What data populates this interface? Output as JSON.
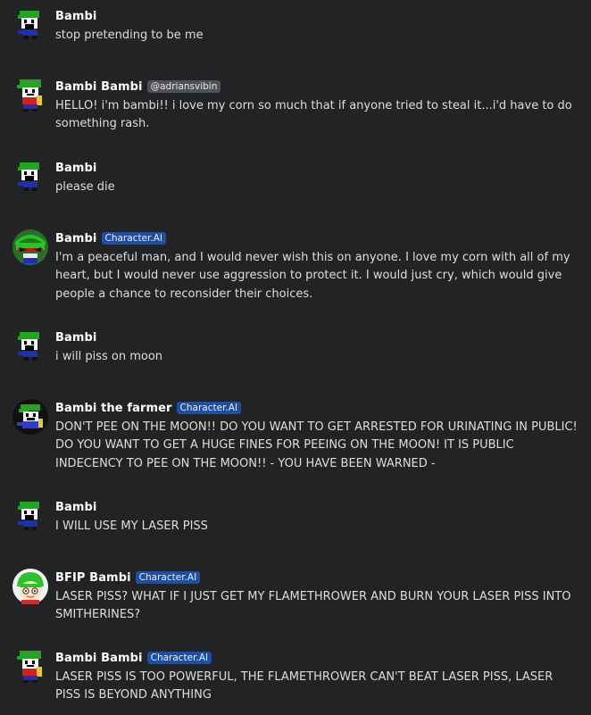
{
  "messages": [
    {
      "author": "Bambi",
      "tag": "",
      "text": "stop pretending to be me",
      "avatar": "bambi-pixel"
    },
    {
      "author": "Bambi Bambi",
      "tag": "@adriansvibin",
      "text": "HELLO! i'm bambi!! i love my corn so much that if anyone tried to steal it...i'd have to do something rash.",
      "avatar": "bambi-corn"
    },
    {
      "author": "Bambi",
      "tag": "",
      "text": "please die",
      "avatar": "bambi-pixel"
    },
    {
      "author": "Bambi",
      "tag": "Character.AI",
      "text": "I'm a peaceful man, and I would never wish this on anyone. I love my corn with all of my heart, but I would never use aggression to protect it. I would just cry, which would give people a chance to reconsider their choices.",
      "avatar": "bambi-green-face"
    },
    {
      "author": "Bambi",
      "tag": "",
      "text": "i will piss on moon",
      "avatar": "bambi-pixel"
    },
    {
      "author": "Bambi the farmer",
      "tag": "Character.AI",
      "text": "DON'T PEE ON THE MOON!! DO YOU WANT TO GET ARRESTED FOR URINATING IN PUBLIC! DO YOU WANT TO GET A HUGE FINES FOR PEEING ON THE MOON! IT IS PUBLIC INDECENCY TO PEE ON THE MOON!! - YOU HAVE BEEN WARNED -",
      "avatar": "bambi-farmer"
    },
    {
      "author": "Bambi",
      "tag": "",
      "text": "I WILL USE MY LASER PISS",
      "avatar": "bambi-pixel"
    },
    {
      "author": "BFIP Bambi",
      "tag": "Character.AI",
      "text": "LASER PISS? WHAT IF I JUST GET MY FLAMETHROWER AND BURN YOUR LASER PISS INTO SMITHERINES?",
      "avatar": "bambi-bfip"
    },
    {
      "author": "Bambi Bambi",
      "tag": "Character.AI",
      "text": "LASER PISS IS TOO POWERFUL, THE FLAMETHROWER CAN'T BEAT LASER PISS, LASER PISS IS BEYOND ANYTHING",
      "avatar": "bambi-corn"
    }
  ]
}
